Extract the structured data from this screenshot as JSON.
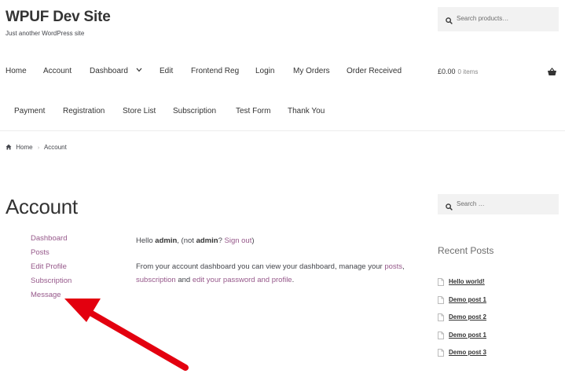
{
  "site": {
    "title": "WPUF Dev Site",
    "tagline": "Just another WordPress site"
  },
  "header_search": {
    "placeholder": "Search products…",
    "icon": "search-icon"
  },
  "nav": {
    "row1": [
      "Home",
      "Account",
      "Dashboard",
      "Edit",
      "Frontend Reg",
      "Login",
      "My Orders",
      "Order Received"
    ],
    "row2": [
      "Payment",
      "Registration",
      "Store List",
      "Subscription",
      "Test Form",
      "Thank You"
    ],
    "dropdown_icon": "chevron-down-icon"
  },
  "cart": {
    "total": "£0.00",
    "items": "0 items",
    "icon": "basket-icon"
  },
  "breadcrumb": {
    "home": "Home",
    "current": "Account",
    "home_icon": "home-icon"
  },
  "page": {
    "title": "Account",
    "account_nav": [
      "Dashboard",
      "Posts",
      "Edit Profile",
      "Subscription",
      "Message"
    ],
    "hello_prefix": "Hello ",
    "user": "admin",
    "not_prefix": ", (not ",
    "not_user": "admin",
    "question": "? ",
    "sign_out": "Sign out",
    "close_paren": ")",
    "intro": "From your account dashboard you can view your dashboard, manage your ",
    "link_posts": "posts",
    "comma": ", ",
    "link_subscription": "subscription",
    "and": " and ",
    "link_edit": "edit your password and profile",
    "period": "."
  },
  "sidebar": {
    "search_placeholder": "Search …",
    "recent_title": "Recent Posts",
    "recent_posts": [
      "Hello world!",
      "Demo post 1",
      "Demo post 2",
      "Demo post 1",
      "Demo post 3"
    ]
  },
  "annotation": {
    "arrow_color": "#e3000f",
    "target": "Message"
  }
}
